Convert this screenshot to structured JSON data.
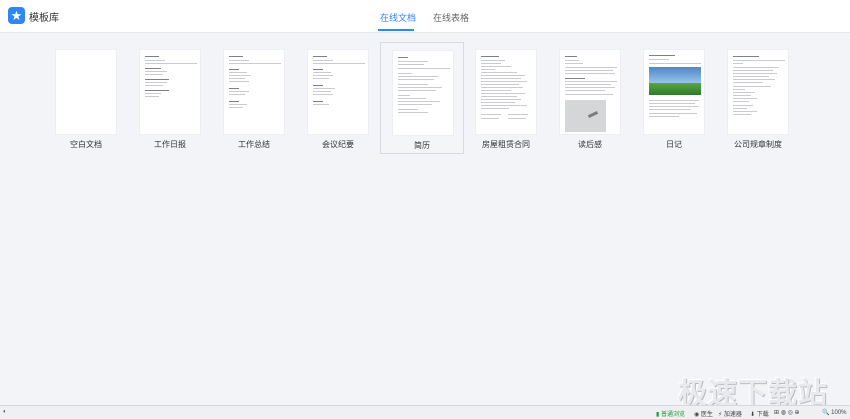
{
  "app": {
    "title": "模板库"
  },
  "tabs": [
    {
      "label": "在线文档",
      "active": true
    },
    {
      "label": "在线表格",
      "active": false
    }
  ],
  "templates": [
    {
      "label": "空白文档"
    },
    {
      "label": "工作日报"
    },
    {
      "label": "工作总结"
    },
    {
      "label": "会议纪要"
    },
    {
      "label": "简历",
      "selected": true
    },
    {
      "label": "房屋租赁合同"
    },
    {
      "label": "读后感"
    },
    {
      "label": "日记"
    },
    {
      "label": "公司规章制度"
    }
  ],
  "statusbar": {
    "green_label": "普通浏览",
    "item2": "医生",
    "item3": "加速器",
    "item4": "下载",
    "zoom": "100%"
  },
  "watermark": "极速下载站",
  "colors": {
    "accent": "#2f86f6",
    "background": "#f3f4f8"
  }
}
